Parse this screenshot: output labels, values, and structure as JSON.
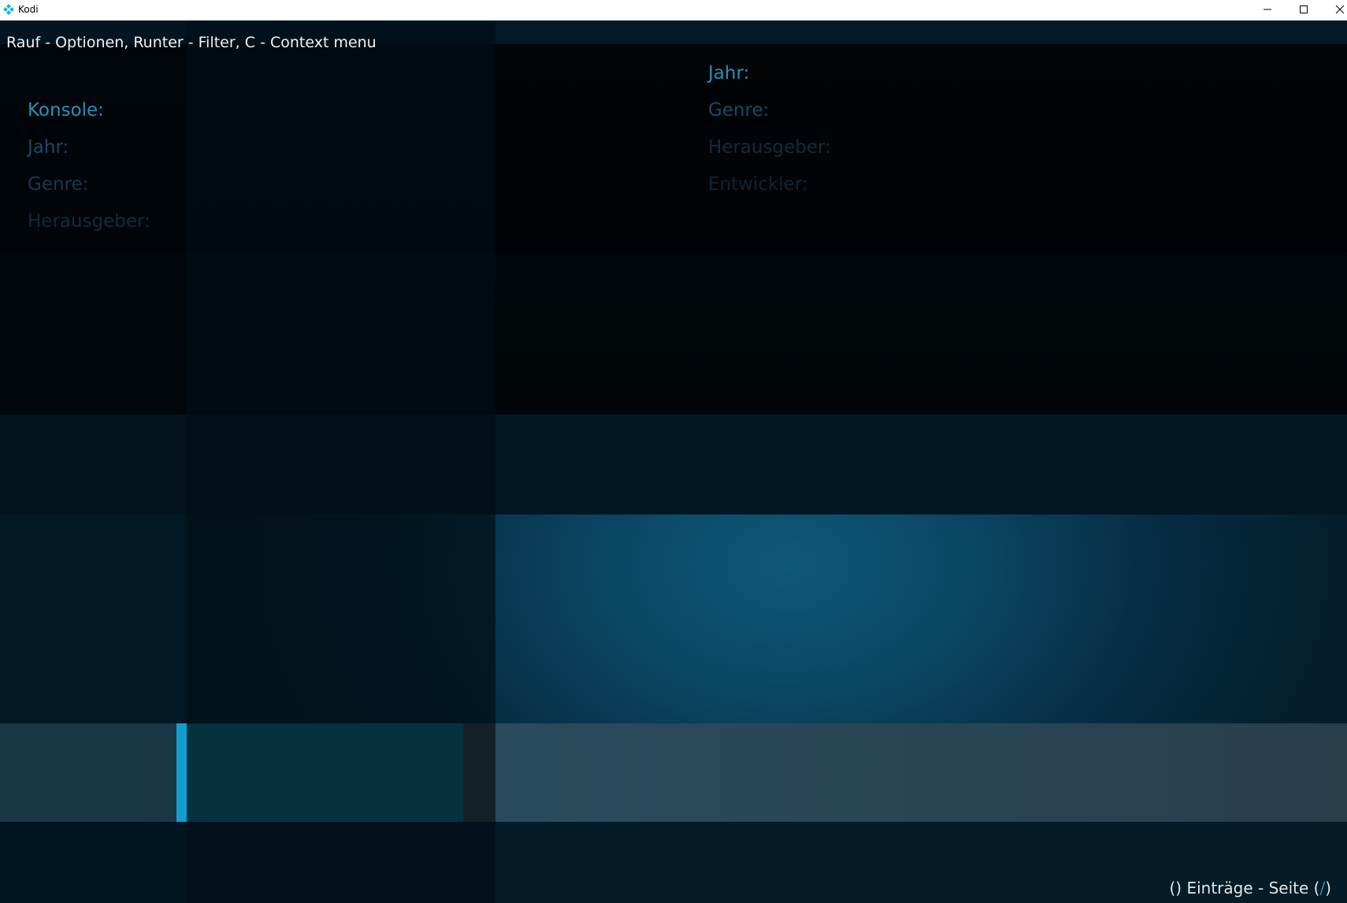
{
  "window": {
    "title": "Kodi",
    "icon": "kodi-icon",
    "controls": [
      "minimize-icon",
      "maximize-icon",
      "close-icon"
    ]
  },
  "header": {
    "hint": "Rauf - Optionen, Runter - Filter, C - Context menu"
  },
  "info_left": {
    "labels": [
      "Konsole:",
      "Jahr:",
      "Genre:",
      "Herausgeber:"
    ]
  },
  "info_right": {
    "labels": [
      "Jahr:",
      "Genre:",
      "Herausgeber:",
      "Entwickler:"
    ]
  },
  "footer": {
    "count_prefix": "() Einträge - Seite (",
    "slash": "/",
    "count_suffix": ")"
  },
  "colors": {
    "accent": "#129fce",
    "label_active": "#2a8fb8",
    "background": "#041e2d"
  }
}
